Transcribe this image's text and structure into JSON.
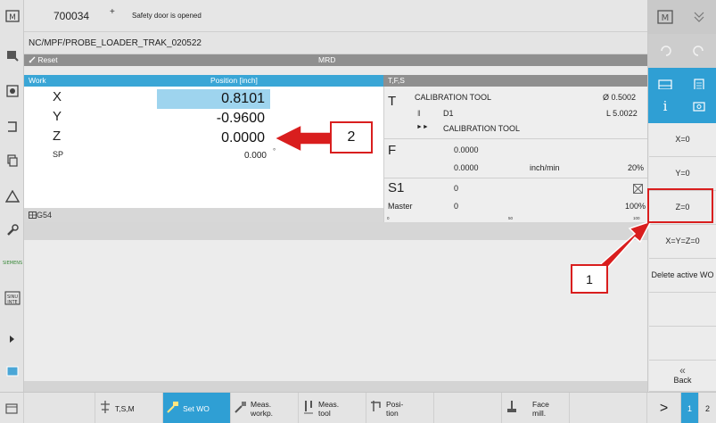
{
  "header": {
    "program_number": "700034",
    "program_marker": "+",
    "alarm": "Safety door is opened",
    "path": "NC/MPF/PROBE_LOADER_TRAK_020522",
    "reset": "Reset",
    "mode": "MRD"
  },
  "work_panel": {
    "title": "Work",
    "position_title": "Position [inch]",
    "axes": [
      {
        "name": "X",
        "value": "0.8101"
      },
      {
        "name": "Y",
        "value": "-0.9600"
      },
      {
        "name": "Z",
        "value": "0.0000"
      }
    ],
    "spindle_name": "SP",
    "spindle_value": "0.000",
    "spindle_unit": "°",
    "work_offset": "G54"
  },
  "tfs_panel": {
    "title": "T,F,S",
    "t_letter": "T",
    "tool_name": "CALIBRATION TOOL",
    "tool_diameter": "Ø 0.5002",
    "d_label": "D1",
    "tool_length": "L 5.0022",
    "next_tool": "CALIBRATION TOOL",
    "f_letter": "F",
    "feed_actual": "0.0000",
    "feed_set": "0.0000",
    "feed_unit": "inch/min",
    "feed_override": "20%",
    "s_letter": "S1",
    "spindle_speed": "0",
    "master_label": "Master",
    "master_speed": "0",
    "spindle_override": "100%",
    "scale_0": "0",
    "scale_50": "50",
    "scale_100": "100"
  },
  "right_softkeys": [
    {
      "label": "X=0"
    },
    {
      "label": "Y=0"
    },
    {
      "label": "Z=0"
    },
    {
      "label": "X=Y=Z=0"
    },
    {
      "label": "Delete active WO"
    },
    {
      "label": ""
    },
    {
      "label": ""
    },
    {
      "label": "Back"
    }
  ],
  "back_arrow": "«",
  "bottom_softkeys": [
    {
      "label": "T,S,M"
    },
    {
      "label": "Set WO"
    },
    {
      "label": "Meas. workp."
    },
    {
      "label": "Meas. tool"
    },
    {
      "label": "Posi- tion"
    },
    {
      "label": "Face mill."
    }
  ],
  "pager": {
    "next": ">",
    "page1": "1",
    "page2": "2"
  },
  "annotations": {
    "marker_1": "1",
    "marker_2": "2",
    "color": "#d91e1e"
  },
  "colors": {
    "accent": "#3aa6d6",
    "highlight": "#9ed4ee",
    "header_gray": "#8f8f8f"
  }
}
